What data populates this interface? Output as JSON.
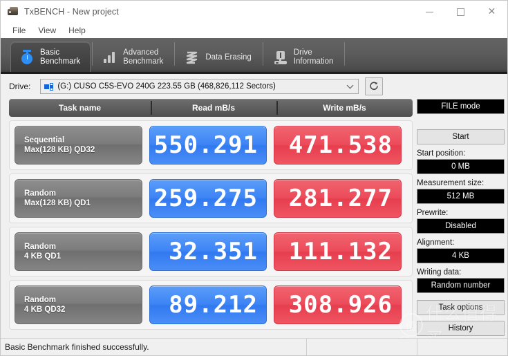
{
  "window": {
    "title": "TxBENCH - New project",
    "icon": "disk-icon",
    "minimize_label": "—",
    "maximize_label": "□",
    "close_label": "✕"
  },
  "menu": {
    "items": [
      {
        "label": "File"
      },
      {
        "label": "View"
      },
      {
        "label": "Help"
      }
    ]
  },
  "tabs": [
    {
      "label": "Basic\nBenchmark",
      "icon": "stopwatch-icon",
      "active": true
    },
    {
      "label": "Advanced\nBenchmark",
      "icon": "bar-chart-icon",
      "active": false
    },
    {
      "label": "Data Erasing",
      "icon": "zigzag-erase-icon",
      "active": false
    },
    {
      "label": "Drive\nInformation",
      "icon": "drive-info-icon",
      "active": false
    }
  ],
  "drive": {
    "label": "Drive:",
    "selected": "(G:) CUSO C5S-EVO 240G  223.55 GB (468,826,112 Sectors)",
    "icon": "disk-drive-icon",
    "dropdown_icon": "chevron-down-icon",
    "refresh_icon": "refresh-icon"
  },
  "results": {
    "columns": [
      "Task name",
      "Read mB/s",
      "Write mB/s"
    ],
    "rows": [
      {
        "task_line1": "Sequential",
        "task_line2": "Max(128 KB) QD32",
        "read": "550.291",
        "write": "471.538"
      },
      {
        "task_line1": "Random",
        "task_line2": "Max(128 KB) QD1",
        "read": "259.275",
        "write": "281.277"
      },
      {
        "task_line1": "Random",
        "task_line2": "4 KB QD1",
        "read": "32.351",
        "write": "111.132"
      },
      {
        "task_line1": "Random",
        "task_line2": "4 KB QD32",
        "read": "89.212",
        "write": "308.926"
      }
    ]
  },
  "sidebar": {
    "mode": "FILE mode",
    "start_button": "Start",
    "start_position_label": "Start position:",
    "start_position_value": "0 MB",
    "measurement_size_label": "Measurement size:",
    "measurement_size_value": "512 MB",
    "prewrite_label": "Prewrite:",
    "prewrite_value": "Disabled",
    "alignment_label": "Alignment:",
    "alignment_value": "4 KB",
    "writing_data_label": "Writing data:",
    "writing_data_value": "Random number",
    "task_options_button": "Task options",
    "history_button": "History"
  },
  "status": {
    "message": "Basic Benchmark finished successfully.",
    "segment2": "",
    "segment3": ""
  },
  "watermark": {
    "text": "什么值得买",
    "logo": "值"
  },
  "colors": {
    "read_blue": "#3d84f5",
    "write_red": "#ec4b5a",
    "tab_dark": "#5c5c5c",
    "task_gray": "#7c7c7c"
  }
}
